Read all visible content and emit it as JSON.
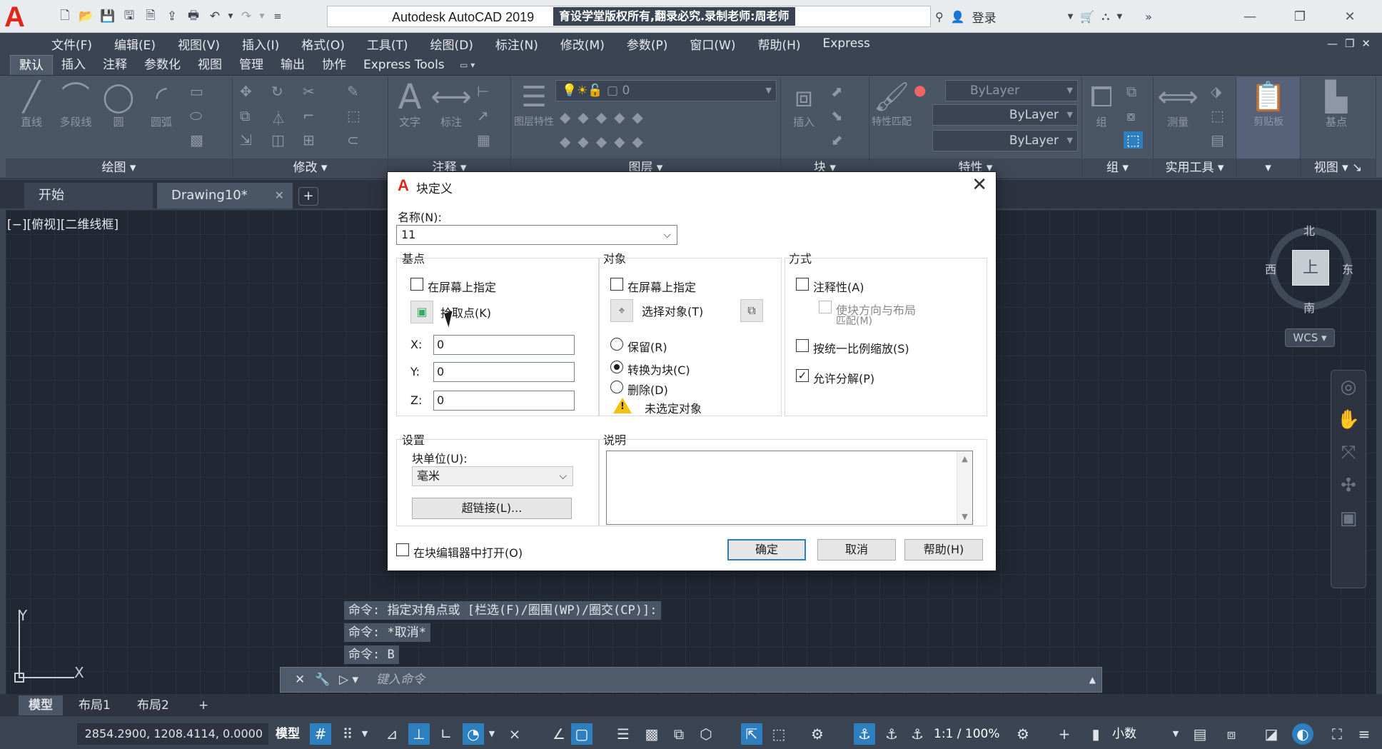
{
  "app": {
    "title": "Autodesk AutoCAD 2019",
    "watermark": "育设学堂版权所有,翻录必究.录制老师:周老师",
    "login": "登录"
  },
  "menu": [
    "文件(F)",
    "编辑(E)",
    "视图(V)",
    "插入(I)",
    "格式(O)",
    "工具(T)",
    "绘图(D)",
    "标注(N)",
    "修改(M)",
    "参数(P)",
    "窗口(W)",
    "帮助(H)",
    "Express"
  ],
  "ribbon_tabs": [
    "默认",
    "插入",
    "注释",
    "参数化",
    "视图",
    "管理",
    "输出",
    "协作",
    "Express Tools"
  ],
  "ribbon": {
    "draw_tools": [
      "直线",
      "多段线",
      "圆",
      "圆弧"
    ],
    "panels": [
      "绘图",
      "修改",
      "注释",
      "图层",
      "块",
      "特性",
      "组",
      "实用工具",
      "视图"
    ],
    "text_tool": "文字",
    "dim_tool": "标注",
    "layer_props": "图层特性",
    "insert_tool": "插入",
    "match_props": "特性匹配",
    "group_tool": "组",
    "measure_tool": "测量",
    "paste_tool": "剪贴板",
    "base_tool": "基点",
    "layer_current": "0",
    "bylayer_color": "ByLayer",
    "bylayer_line": "ByLayer",
    "bylayer_weight": "ByLayer"
  },
  "doc_tabs": {
    "start": "开始",
    "drawing": "Drawing10*"
  },
  "viewport": {
    "label": "[−][俯视][二维线框]",
    "compass": {
      "north": "北",
      "south": "南",
      "east": "东",
      "west": "西",
      "face": "上"
    },
    "wcs": "WCS",
    "ucs_x": "X",
    "ucs_y": "Y"
  },
  "command_history": [
    "命令: 指定对角点或 [栏选(F)/圈围(WP)/圈交(CP)]:",
    "命令: *取消*",
    "命令: B"
  ],
  "command_prompt": "键入命令",
  "layout_tabs": [
    "模型",
    "布局1",
    "布局2"
  ],
  "status": {
    "coords": "2854.2900, 1208.4114, 0.0000",
    "model": "模型",
    "scale": "1:1 / 100%",
    "units": "小数"
  },
  "dialog": {
    "title": "块定义",
    "name_label": "名称(N):",
    "name_value": "11",
    "basepoint": {
      "title": "基点",
      "specify_on_screen": "在屏幕上指定",
      "pick_point": "拾取点(K)",
      "x_label": "X:",
      "y_label": "Y:",
      "z_label": "Z:",
      "x": "0",
      "y": "0",
      "z": "0"
    },
    "objects": {
      "title": "对象",
      "specify_on_screen": "在屏幕上指定",
      "select_objects": "选择对象(T)",
      "retain": "保留(R)",
      "convert": "转换为块(C)",
      "delete": "删除(D)",
      "none_selected": "未选定对象"
    },
    "behavior": {
      "title": "方式",
      "annotative": "注释性(A)",
      "match_orientation_1": "使块方向与布局",
      "match_orientation_2": "匹配(M)",
      "scale_uniformly": "按统一比例缩放(S)",
      "allow_explode": "允许分解(P)"
    },
    "settings": {
      "title": "设置",
      "block_unit_label": "块单位(U):",
      "block_unit": "毫米",
      "hyperlink": "超链接(L)..."
    },
    "description": {
      "title": "说明"
    },
    "open_in_editor": "在块编辑器中打开(O)",
    "ok": "确定",
    "cancel": "取消",
    "help": "帮助(H)"
  }
}
